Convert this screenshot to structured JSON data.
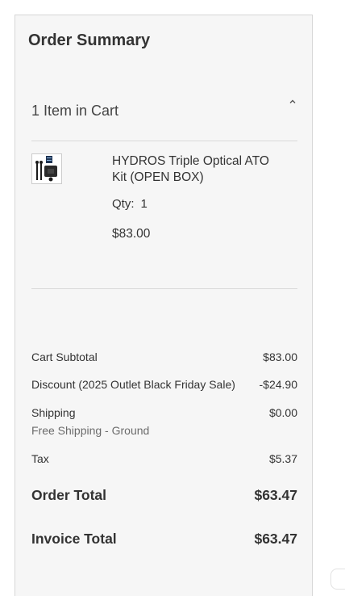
{
  "summary": {
    "title": "Order Summary",
    "cart_count_label": "1 Item in Cart",
    "toggle_icon": "chevron-up-icon"
  },
  "item": {
    "name": "HYDROS Triple Optical ATO Kit (OPEN BOX)",
    "qty_label": "Qty:",
    "qty_value": "1",
    "price": "$83.00",
    "image_icon": "product-thumbnail"
  },
  "totals": {
    "subtotal_label": "Cart Subtotal",
    "subtotal_value": "$83.00",
    "discount_label": "Discount (2025 Outlet Black Friday Sale)",
    "discount_value": "-$24.90",
    "shipping_label": "Shipping",
    "shipping_method": "Free Shipping - Ground",
    "shipping_value": "$0.00",
    "tax_label": "Tax",
    "tax_value": "$5.37",
    "order_total_label": "Order Total",
    "order_total_value": "$63.47",
    "invoice_total_label": "Invoice Total",
    "invoice_total_value": "$63.47"
  },
  "colors": {
    "panel_bg": "#f6f6f6",
    "border": "#d6d6d6",
    "text": "#333333",
    "muted": "#6b6b6b"
  }
}
